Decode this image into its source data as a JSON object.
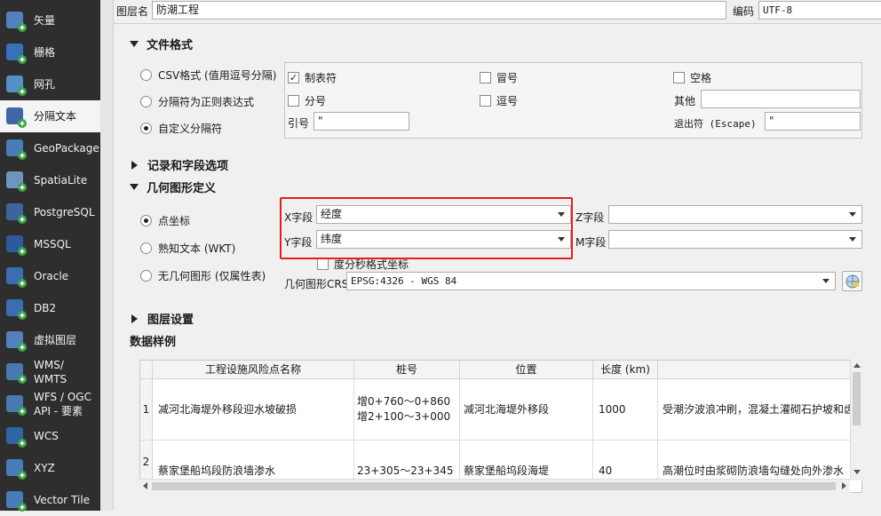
{
  "sidebar": {
    "items": [
      {
        "label": "矢量",
        "icon": "vector-icon"
      },
      {
        "label": "栅格",
        "icon": "raster-icon"
      },
      {
        "label": "网孔",
        "icon": "mesh-icon"
      },
      {
        "label": "分隔文本",
        "icon": "delimited-text-icon"
      },
      {
        "label": "GeoPackage",
        "icon": "geopackage-icon"
      },
      {
        "label": "SpatiaLite",
        "icon": "spatialite-icon"
      },
      {
        "label": "PostgreSQL",
        "icon": "postgresql-icon"
      },
      {
        "label": "MSSQL",
        "icon": "mssql-icon"
      },
      {
        "label": "Oracle",
        "icon": "oracle-icon"
      },
      {
        "label": "DB2",
        "icon": "db2-icon"
      },
      {
        "label": "虚拟图层",
        "icon": "virtual-layer-icon"
      },
      {
        "label": "WMS/\nWMTS",
        "icon": "wms-icon"
      },
      {
        "label": "WFS / OGC\nAPI - 要素",
        "icon": "wfs-icon"
      },
      {
        "label": "WCS",
        "icon": "wcs-icon"
      },
      {
        "label": "XYZ",
        "icon": "xyz-icon"
      },
      {
        "label": "Vector Tile",
        "icon": "vector-tile-icon"
      }
    ],
    "active_index": 3
  },
  "top": {
    "layer_name_label": "图层名",
    "layer_name_value": "防潮工程",
    "encoding_label": "编码",
    "encoding_value": "UTF-8"
  },
  "file_format": {
    "title": "文件格式",
    "csv_option": "CSV格式 (值用逗号分隔)",
    "regex_option": "分隔符为正则表达式",
    "custom_option": "自定义分隔符",
    "tab_label": "制表符",
    "colon_label": "冒号",
    "space_label": "空格",
    "semicolon_label": "分号",
    "comma_label": "逗号",
    "other_label": "其他",
    "quote_label": "引号",
    "quote_value": "\"",
    "escape_label": "退出符 (Escape)",
    "escape_value": "\""
  },
  "records_section": {
    "title": "记录和字段选项"
  },
  "geometry": {
    "title": "几何图形定义",
    "point_option": "点坐标",
    "wkt_option": "熟知文本 (WKT)",
    "no_geom_option": "无几何图形 (仅属性表)",
    "x_label": "X字段",
    "x_value": "经度",
    "y_label": "Y字段",
    "y_value": "纬度",
    "z_label": "Z字段",
    "m_label": "M字段",
    "dms_label": "度分秒格式坐标",
    "crs_label": "几何图形CRS",
    "crs_value": "EPSG:4326 - WGS 84"
  },
  "layer_settings": {
    "title": "图层设置"
  },
  "sample": {
    "title": "数据样例",
    "columns": [
      "工程设施风险点名称",
      "桩号",
      "位置",
      "长度 (km)"
    ],
    "rows": [
      {
        "num": "1",
        "name": "减河北海堤外移段迎水坡破损",
        "stake1": "增0+760～0+860",
        "stake2": "增2+100～3+000",
        "location": "减河北海堤外移段",
        "length": "1000",
        "desc": "受潮汐波浪冲刷，混凝土灌砌石护坡和齿"
      },
      {
        "num": "2",
        "name": "蔡家堡船坞段防浪墙渗水",
        "stake1": "23+305～23+345",
        "stake2": "",
        "location": "蔡家堡船坞段海堤",
        "length": "40",
        "desc": "高潮位时由浆砌防浪墙勾缝处向外渗水"
      }
    ]
  }
}
